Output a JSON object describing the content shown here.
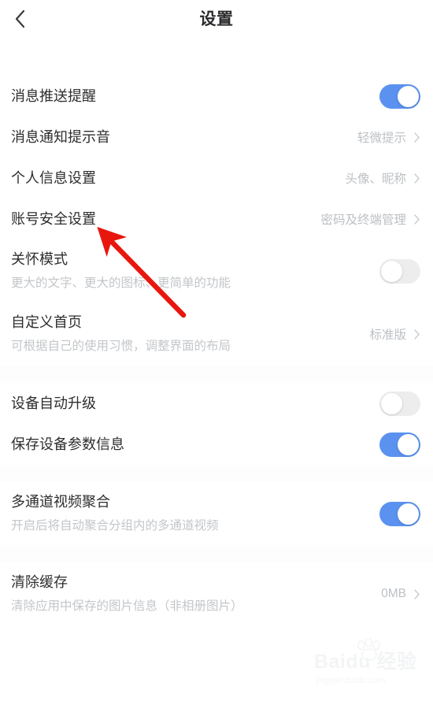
{
  "header": {
    "title": "设置",
    "back_icon": "chevron-left-icon"
  },
  "sections": [
    {
      "rows": [
        {
          "title": "消息推送提醒",
          "control": "toggle",
          "state": "on"
        },
        {
          "title": "消息通知提示音",
          "control": "value",
          "value": "轻微提示"
        },
        {
          "title": "个人信息设置",
          "control": "value",
          "value": "头像、昵称"
        },
        {
          "title": "账号安全设置",
          "control": "value",
          "value": "密码及终端管理"
        },
        {
          "title": "关怀模式",
          "subtitle": "更大的文字、更大的图标、更简单的功能",
          "control": "toggle",
          "state": "off"
        },
        {
          "title": "自定义首页",
          "subtitle": "可根据自己的使用习惯，调整界面的布局",
          "control": "value",
          "value": "标准版"
        }
      ]
    },
    {
      "rows": [
        {
          "title": "设备自动升级",
          "control": "toggle",
          "state": "off"
        },
        {
          "title": "保存设备参数信息",
          "control": "toggle",
          "state": "on"
        }
      ]
    },
    {
      "rows": [
        {
          "title": "多通道视频聚合",
          "subtitle": "开启后将自动聚合分组内的多通道视频",
          "control": "toggle",
          "state": "on"
        }
      ]
    },
    {
      "rows": [
        {
          "title": "清除缓存",
          "subtitle": "清除应用中保存的图片信息（非相册图片）",
          "control": "value",
          "value": "0MB"
        }
      ]
    }
  ],
  "annotation": {
    "type": "arrow",
    "color": "#e8170e",
    "target": "账号安全设置"
  },
  "watermark": {
    "brand": "Baidu 经验",
    "site": "jingyan.baidu.com",
    "logo_icon": "paw-icon"
  },
  "colors": {
    "accent_on": "#5b92f0",
    "track_off": "#ededee",
    "title_text": "#2e2e30",
    "value_text": "#bcc0c4",
    "annotation_red": "#e8170e"
  }
}
